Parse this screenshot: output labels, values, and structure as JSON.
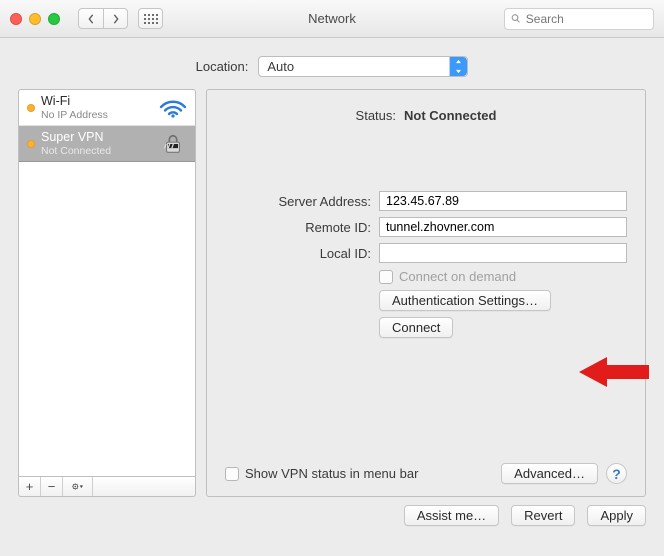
{
  "titlebar": {
    "title": "Network",
    "search_placeholder": "Search"
  },
  "location": {
    "label": "Location:",
    "value": "Auto"
  },
  "sidebar": {
    "items": [
      {
        "name": "Wi-Fi",
        "sub": "No IP Address"
      },
      {
        "name": "Super VPN",
        "sub": "Not Connected"
      }
    ],
    "tools": {
      "add": "+",
      "remove": "−"
    }
  },
  "panel": {
    "status_label": "Status:",
    "status_value": "Not Connected",
    "fields": {
      "server_address_label": "Server Address:",
      "server_address_value": "123.45.67.89",
      "remote_id_label": "Remote ID:",
      "remote_id_value": "tunnel.zhovner.com",
      "local_id_label": "Local ID:",
      "local_id_value": ""
    },
    "connect_on_demand": "Connect on demand",
    "auth_settings_btn": "Authentication Settings…",
    "connect_btn": "Connect",
    "show_vpn_status": "Show VPN status in menu bar",
    "advanced_btn": "Advanced…",
    "help": "?"
  },
  "footer": {
    "assist": "Assist me…",
    "revert": "Revert",
    "apply": "Apply"
  }
}
